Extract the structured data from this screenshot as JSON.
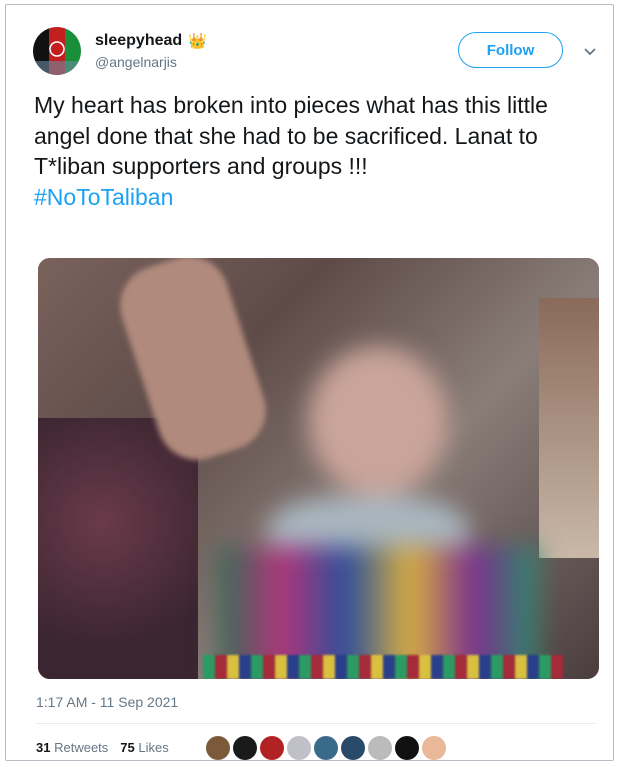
{
  "user": {
    "display_name": "sleepyhead",
    "badge_icon": "crown-icon",
    "handle": "@angelnarjis"
  },
  "follow_label": "Follow",
  "tweet": {
    "text": "My heart has broken into pieces what has this little angel done that she had to be sacrificed. Lanat to T*liban supporters and groups !!!",
    "hashtag": "#NoToTaliban"
  },
  "timestamp": "1:17 AM - 11 Sep 2021",
  "stats": {
    "retweets_count": "31",
    "retweets_label": "Retweets",
    "likes_count": "75",
    "likes_label": "Likes"
  },
  "likers": [
    "#7a5a3a",
    "#1a1a1a",
    "#b22222",
    "#c0c0c8",
    "#3a6a8a",
    "#2a4a6a",
    "#bbbbbb",
    "#111111",
    "#e8b898"
  ],
  "colors": {
    "accent": "#1da1f2",
    "text": "#14171a",
    "muted": "#657786"
  }
}
